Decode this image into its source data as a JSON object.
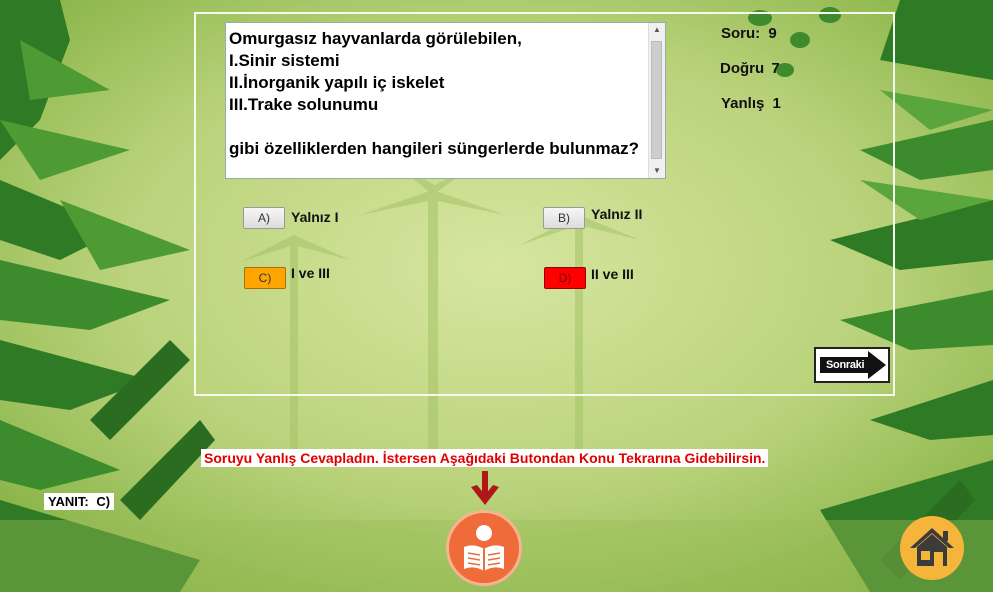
{
  "question": {
    "text": "Omurgasız hayvanlarda görülebilen,\nI.Sinir sistemi\nII.İnorganik yapılı iç iskelet\nIII.Trake solunumu\n\ngibi özelliklerden hangileri süngerlerde bulunmaz?"
  },
  "stats": {
    "soru_label": "Soru:",
    "soru_value": "9",
    "dogru_label": "Doğru",
    "dogru_value": "7",
    "yanlis_label": "Yanlış",
    "yanlis_value": "1"
  },
  "options": {
    "a": {
      "button": "A)",
      "label": "Yalnız I"
    },
    "b": {
      "button": "B)",
      "label": "Yalnız II"
    },
    "c": {
      "button": "C)",
      "label": "I ve III"
    },
    "d": {
      "button": "D)",
      "label": "II ve III"
    }
  },
  "next_button": {
    "label": "Sonraki"
  },
  "feedback": {
    "message": "Soruyu Yanlış Cevapladın. İstersen Aşağıdaki Butondan Konu Tekrarına Gidebilirsin."
  },
  "answer": {
    "label": "YANIT:",
    "value": "C)"
  },
  "colors": {
    "selected_option": "#ffa500",
    "wrong_option": "#ff0000",
    "feedback_text": "#e00000",
    "review_button": "#ef6c3a",
    "home_button": "#f5b43a"
  },
  "icons": {
    "review": "reading-person-icon",
    "home": "house-icon",
    "arrow": "arrow-down-icon"
  }
}
